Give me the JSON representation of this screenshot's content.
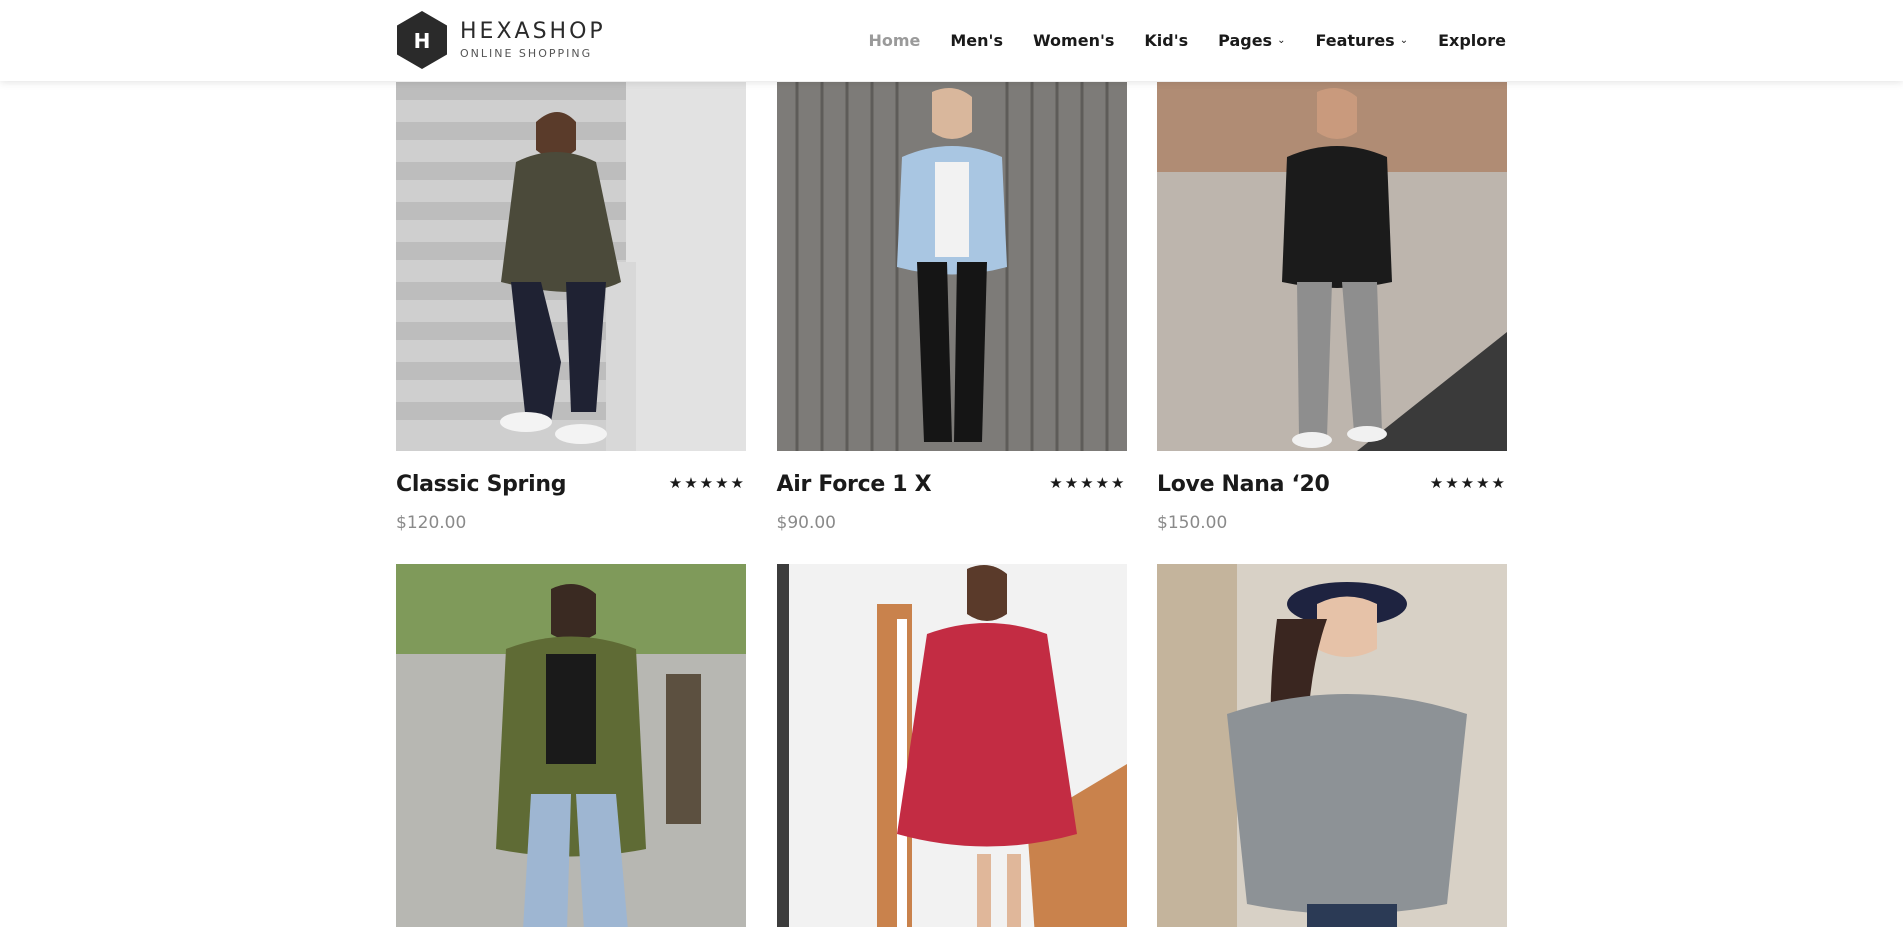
{
  "brand": {
    "letter": "H",
    "name": "HEXASHOP",
    "tagline": "ONLINE SHOPPING"
  },
  "nav": [
    {
      "label": "Home",
      "active": true
    },
    {
      "label": "Men's"
    },
    {
      "label": "Women's"
    },
    {
      "label": "Kid's"
    },
    {
      "label": "Pages",
      "dropdown": true
    },
    {
      "label": "Features",
      "dropdown": true
    },
    {
      "label": "Explore"
    }
  ],
  "products": [
    {
      "title": "Classic Spring",
      "price": "$120.00",
      "rating": "★★★★★"
    },
    {
      "title": "Air Force 1 X",
      "price": "$90.00",
      "rating": "★★★★★"
    },
    {
      "title": "Love Nana ‘20",
      "price": "$150.00",
      "rating": "★★★★★"
    }
  ],
  "colors": {
    "logo": "#2a2a2a",
    "text": "#1a1a1a",
    "muted": "#8a8a8a",
    "nav_active": "#9a9a9a"
  }
}
